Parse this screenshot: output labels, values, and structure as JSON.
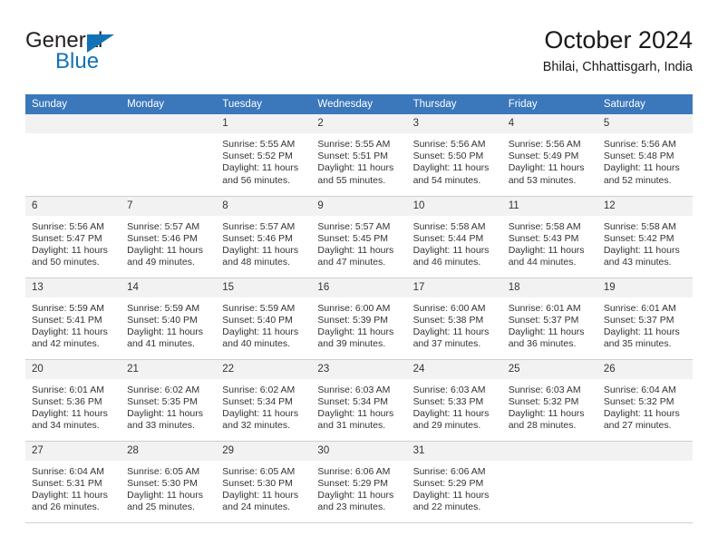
{
  "brand": {
    "name_top": "General",
    "name_bottom": "Blue",
    "triangle_color": "#1272b6",
    "text_color": "#231f20"
  },
  "header": {
    "title": "October 2024",
    "subtitle": "Bhilai, Chhattisgarh, India",
    "header_bg": "#3a77bb",
    "header_text_color": "#ffffff",
    "daynum_bg": "#f2f2f2"
  },
  "weekday_headers": [
    "Sunday",
    "Monday",
    "Tuesday",
    "Wednesday",
    "Thursday",
    "Friday",
    "Saturday"
  ],
  "weeks": [
    [
      {
        "day": "",
        "sunrise": "",
        "sunset": "",
        "daylight_line1": "",
        "daylight_line2": ""
      },
      {
        "day": "",
        "sunrise": "",
        "sunset": "",
        "daylight_line1": "",
        "daylight_line2": ""
      },
      {
        "day": "1",
        "sunrise": "Sunrise: 5:55 AM",
        "sunset": "Sunset: 5:52 PM",
        "daylight_line1": "Daylight: 11 hours",
        "daylight_line2": "and 56 minutes."
      },
      {
        "day": "2",
        "sunrise": "Sunrise: 5:55 AM",
        "sunset": "Sunset: 5:51 PM",
        "daylight_line1": "Daylight: 11 hours",
        "daylight_line2": "and 55 minutes."
      },
      {
        "day": "3",
        "sunrise": "Sunrise: 5:56 AM",
        "sunset": "Sunset: 5:50 PM",
        "daylight_line1": "Daylight: 11 hours",
        "daylight_line2": "and 54 minutes."
      },
      {
        "day": "4",
        "sunrise": "Sunrise: 5:56 AM",
        "sunset": "Sunset: 5:49 PM",
        "daylight_line1": "Daylight: 11 hours",
        "daylight_line2": "and 53 minutes."
      },
      {
        "day": "5",
        "sunrise": "Sunrise: 5:56 AM",
        "sunset": "Sunset: 5:48 PM",
        "daylight_line1": "Daylight: 11 hours",
        "daylight_line2": "and 52 minutes."
      }
    ],
    [
      {
        "day": "6",
        "sunrise": "Sunrise: 5:56 AM",
        "sunset": "Sunset: 5:47 PM",
        "daylight_line1": "Daylight: 11 hours",
        "daylight_line2": "and 50 minutes."
      },
      {
        "day": "7",
        "sunrise": "Sunrise: 5:57 AM",
        "sunset": "Sunset: 5:46 PM",
        "daylight_line1": "Daylight: 11 hours",
        "daylight_line2": "and 49 minutes."
      },
      {
        "day": "8",
        "sunrise": "Sunrise: 5:57 AM",
        "sunset": "Sunset: 5:46 PM",
        "daylight_line1": "Daylight: 11 hours",
        "daylight_line2": "and 48 minutes."
      },
      {
        "day": "9",
        "sunrise": "Sunrise: 5:57 AM",
        "sunset": "Sunset: 5:45 PM",
        "daylight_line1": "Daylight: 11 hours",
        "daylight_line2": "and 47 minutes."
      },
      {
        "day": "10",
        "sunrise": "Sunrise: 5:58 AM",
        "sunset": "Sunset: 5:44 PM",
        "daylight_line1": "Daylight: 11 hours",
        "daylight_line2": "and 46 minutes."
      },
      {
        "day": "11",
        "sunrise": "Sunrise: 5:58 AM",
        "sunset": "Sunset: 5:43 PM",
        "daylight_line1": "Daylight: 11 hours",
        "daylight_line2": "and 44 minutes."
      },
      {
        "day": "12",
        "sunrise": "Sunrise: 5:58 AM",
        "sunset": "Sunset: 5:42 PM",
        "daylight_line1": "Daylight: 11 hours",
        "daylight_line2": "and 43 minutes."
      }
    ],
    [
      {
        "day": "13",
        "sunrise": "Sunrise: 5:59 AM",
        "sunset": "Sunset: 5:41 PM",
        "daylight_line1": "Daylight: 11 hours",
        "daylight_line2": "and 42 minutes."
      },
      {
        "day": "14",
        "sunrise": "Sunrise: 5:59 AM",
        "sunset": "Sunset: 5:40 PM",
        "daylight_line1": "Daylight: 11 hours",
        "daylight_line2": "and 41 minutes."
      },
      {
        "day": "15",
        "sunrise": "Sunrise: 5:59 AM",
        "sunset": "Sunset: 5:40 PM",
        "daylight_line1": "Daylight: 11 hours",
        "daylight_line2": "and 40 minutes."
      },
      {
        "day": "16",
        "sunrise": "Sunrise: 6:00 AM",
        "sunset": "Sunset: 5:39 PM",
        "daylight_line1": "Daylight: 11 hours",
        "daylight_line2": "and 39 minutes."
      },
      {
        "day": "17",
        "sunrise": "Sunrise: 6:00 AM",
        "sunset": "Sunset: 5:38 PM",
        "daylight_line1": "Daylight: 11 hours",
        "daylight_line2": "and 37 minutes."
      },
      {
        "day": "18",
        "sunrise": "Sunrise: 6:01 AM",
        "sunset": "Sunset: 5:37 PM",
        "daylight_line1": "Daylight: 11 hours",
        "daylight_line2": "and 36 minutes."
      },
      {
        "day": "19",
        "sunrise": "Sunrise: 6:01 AM",
        "sunset": "Sunset: 5:37 PM",
        "daylight_line1": "Daylight: 11 hours",
        "daylight_line2": "and 35 minutes."
      }
    ],
    [
      {
        "day": "20",
        "sunrise": "Sunrise: 6:01 AM",
        "sunset": "Sunset: 5:36 PM",
        "daylight_line1": "Daylight: 11 hours",
        "daylight_line2": "and 34 minutes."
      },
      {
        "day": "21",
        "sunrise": "Sunrise: 6:02 AM",
        "sunset": "Sunset: 5:35 PM",
        "daylight_line1": "Daylight: 11 hours",
        "daylight_line2": "and 33 minutes."
      },
      {
        "day": "22",
        "sunrise": "Sunrise: 6:02 AM",
        "sunset": "Sunset: 5:34 PM",
        "daylight_line1": "Daylight: 11 hours",
        "daylight_line2": "and 32 minutes."
      },
      {
        "day": "23",
        "sunrise": "Sunrise: 6:03 AM",
        "sunset": "Sunset: 5:34 PM",
        "daylight_line1": "Daylight: 11 hours",
        "daylight_line2": "and 31 minutes."
      },
      {
        "day": "24",
        "sunrise": "Sunrise: 6:03 AM",
        "sunset": "Sunset: 5:33 PM",
        "daylight_line1": "Daylight: 11 hours",
        "daylight_line2": "and 29 minutes."
      },
      {
        "day": "25",
        "sunrise": "Sunrise: 6:03 AM",
        "sunset": "Sunset: 5:32 PM",
        "daylight_line1": "Daylight: 11 hours",
        "daylight_line2": "and 28 minutes."
      },
      {
        "day": "26",
        "sunrise": "Sunrise: 6:04 AM",
        "sunset": "Sunset: 5:32 PM",
        "daylight_line1": "Daylight: 11 hours",
        "daylight_line2": "and 27 minutes."
      }
    ],
    [
      {
        "day": "27",
        "sunrise": "Sunrise: 6:04 AM",
        "sunset": "Sunset: 5:31 PM",
        "daylight_line1": "Daylight: 11 hours",
        "daylight_line2": "and 26 minutes."
      },
      {
        "day": "28",
        "sunrise": "Sunrise: 6:05 AM",
        "sunset": "Sunset: 5:30 PM",
        "daylight_line1": "Daylight: 11 hours",
        "daylight_line2": "and 25 minutes."
      },
      {
        "day": "29",
        "sunrise": "Sunrise: 6:05 AM",
        "sunset": "Sunset: 5:30 PM",
        "daylight_line1": "Daylight: 11 hours",
        "daylight_line2": "and 24 minutes."
      },
      {
        "day": "30",
        "sunrise": "Sunrise: 6:06 AM",
        "sunset": "Sunset: 5:29 PM",
        "daylight_line1": "Daylight: 11 hours",
        "daylight_line2": "and 23 minutes."
      },
      {
        "day": "31",
        "sunrise": "Sunrise: 6:06 AM",
        "sunset": "Sunset: 5:29 PM",
        "daylight_line1": "Daylight: 11 hours",
        "daylight_line2": "and 22 minutes."
      },
      {
        "day": "",
        "sunrise": "",
        "sunset": "",
        "daylight_line1": "",
        "daylight_line2": ""
      },
      {
        "day": "",
        "sunrise": "",
        "sunset": "",
        "daylight_line1": "",
        "daylight_line2": ""
      }
    ]
  ]
}
